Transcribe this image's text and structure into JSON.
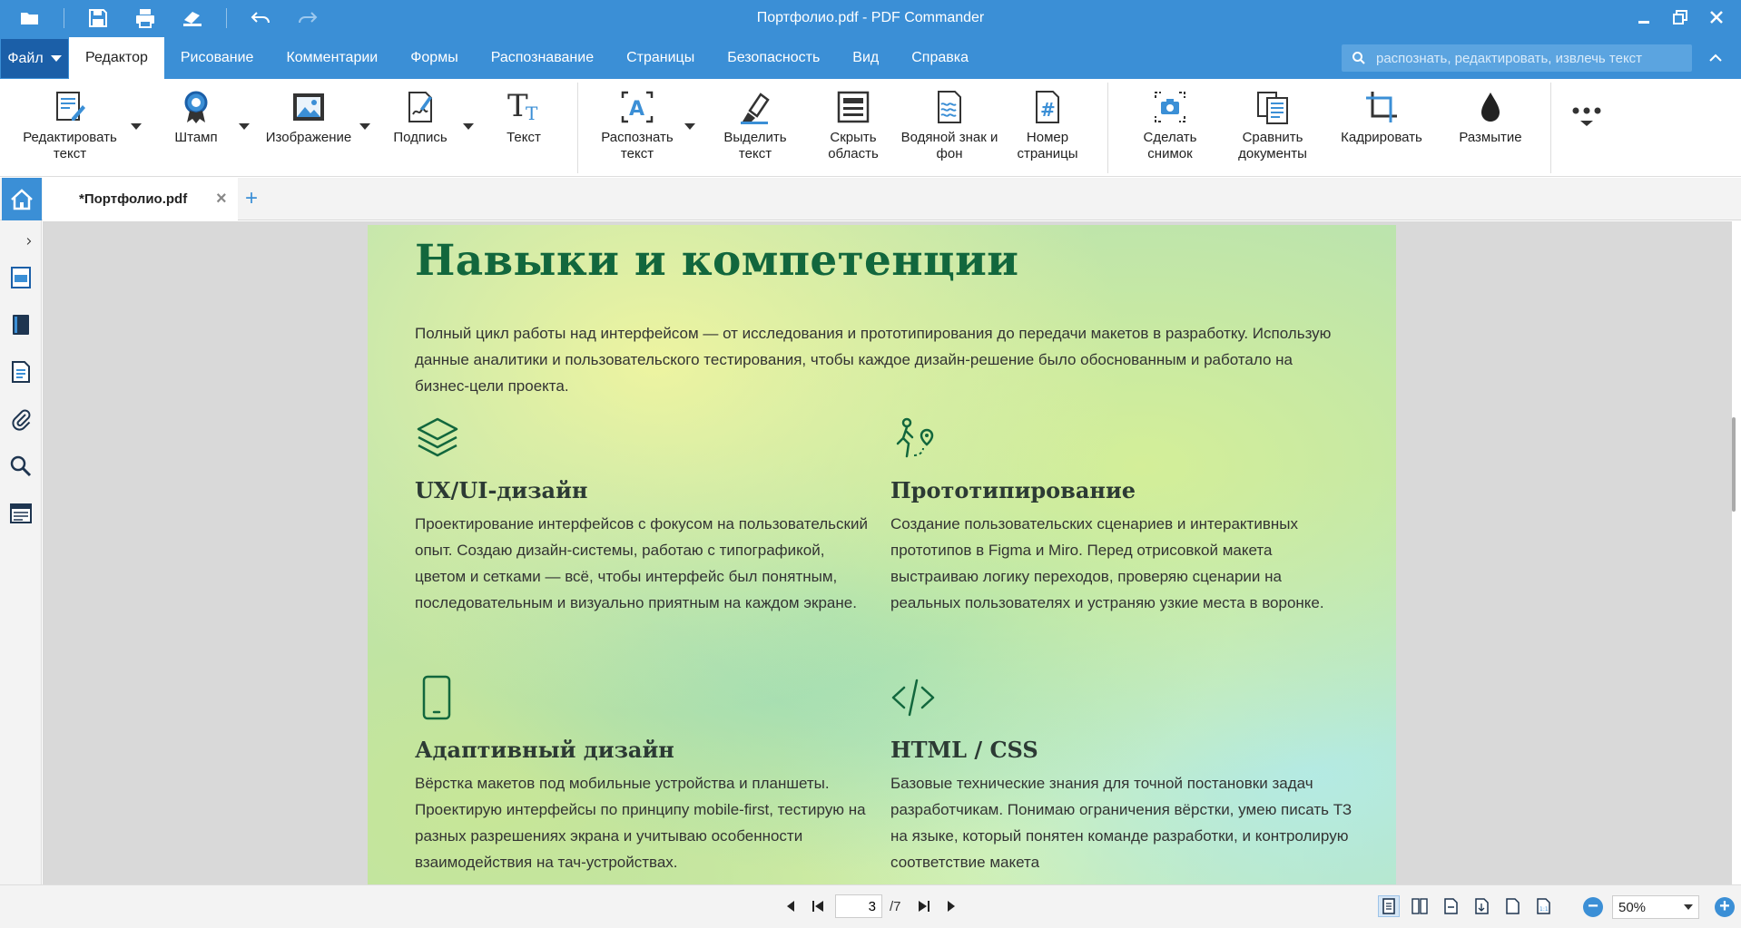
{
  "window": {
    "title": "Портфолио.pdf - PDF Commander"
  },
  "menu": {
    "file_label": "Файл",
    "tabs": [
      {
        "label": "Редактор",
        "active": true
      },
      {
        "label": "Рисование"
      },
      {
        "label": "Комментарии"
      },
      {
        "label": "Формы"
      },
      {
        "label": "Распознавание"
      },
      {
        "label": "Страницы"
      },
      {
        "label": "Безопасность"
      },
      {
        "label": "Вид"
      },
      {
        "label": "Справка"
      }
    ],
    "search_placeholder": "распознать, редактировать, извлечь текст"
  },
  "ribbon": {
    "edit_text": "Редактировать текст",
    "stamp": "Штамп",
    "image": "Изображение",
    "signature": "Подпись",
    "text": "Текст",
    "recognize_text": "Распознать текст",
    "highlight_text": "Выделить текст",
    "hide_area": "Скрыть область",
    "watermark": "Водяной знак и фон",
    "page_number": "Номер страницы",
    "snapshot": "Сделать снимок",
    "compare": "Сравнить документы",
    "crop": "Кадрировать",
    "blur": "Размытие"
  },
  "document_tab": {
    "name": "*Портфолио.pdf"
  },
  "page_content": {
    "title": "Навыки и компетенции",
    "intro": "Полный цикл работы над интерфейсом — от исследования и прототипирования до передачи макетов в разработку. Использую данные аналитики и пользовательского тестирования, чтобы каждое дизайн-решение было обоснованным и работало на бизнес-цели проекта.",
    "skills": [
      {
        "icon": "layers-icon",
        "title": "UX/UI-дизайн",
        "text": "Проектирование интерфейсов с фокусом на пользовательский опыт. Создаю дизайн-системы, работаю с типографикой, цветом и сетками — всё, чтобы интерфейс был понятным, последовательным и визуально приятным на каждом экране."
      },
      {
        "icon": "route-icon",
        "title": "Прототипирование",
        "text": "Создание пользовательских сценариев и интерактивных прототипов в Figma и Miro. Перед отрисовкой макета выстраиваю логику переходов, проверяю сценарии на реальных пользователях и устраняю узкие места в воронке."
      },
      {
        "icon": "smartphone-icon",
        "title": "Адаптивный дизайн",
        "text": "Вёрстка макетов под мобильные устройства и планшеты. Проектирую интерфейсы по принципу mobile-first, тестирую на разных разрешениях экрана и учитываю особенности взаимодействия на тач-устройствах."
      },
      {
        "icon": "code-icon",
        "title": "HTML / CSS",
        "text": "Базовые технические знания для точной постановки задач разработчикам. Понимаю ограничения вёрстки, умею писать ТЗ на языке, который понятен команде разработки, и контролирую соответствие макета"
      }
    ]
  },
  "statusbar": {
    "current_page": "3",
    "total_pages": "/7",
    "zoom": "50%"
  },
  "colors": {
    "accent": "#3b8fd6",
    "file_button": "#1b5fa8",
    "heading_green": "#12673d"
  }
}
